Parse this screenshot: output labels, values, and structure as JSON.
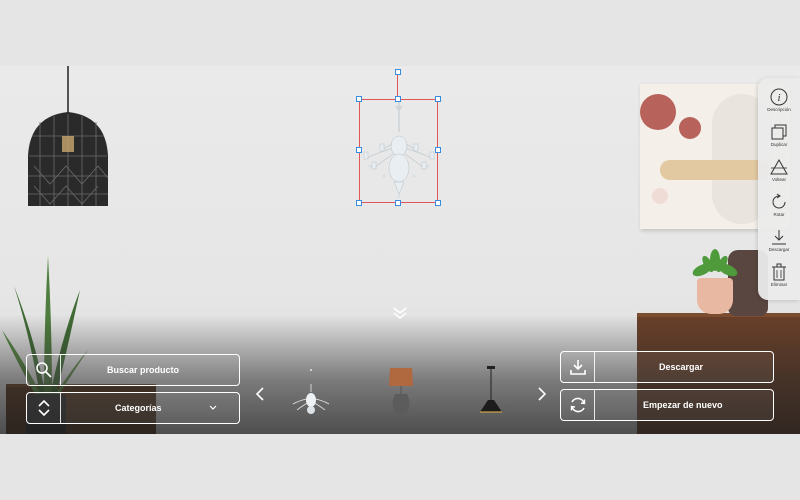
{
  "toolbar": {
    "items": [
      {
        "label": "Descripción",
        "icon": "info-icon"
      },
      {
        "label": "Duplicar",
        "icon": "duplicate-icon"
      },
      {
        "label": "Voltear",
        "icon": "flip-icon"
      },
      {
        "label": "Rotar",
        "icon": "rotate-icon"
      },
      {
        "label": "Descargar",
        "icon": "download-icon"
      },
      {
        "label": "Eliminar",
        "icon": "trash-icon"
      }
    ]
  },
  "controls": {
    "search_label": "Buscar producto",
    "categories_label": "Categorías",
    "download_label": "Descargar",
    "restart_label": "Empezar de nuevo"
  },
  "carousel": {
    "items": [
      "chandelier-thumbnail",
      "table-lamp-thumbnail",
      "pendant-lamp-thumbnail"
    ]
  },
  "colors": {
    "selection_border": "#e05656",
    "handle_border": "#3a8dde",
    "button_border": "#ffffff"
  }
}
